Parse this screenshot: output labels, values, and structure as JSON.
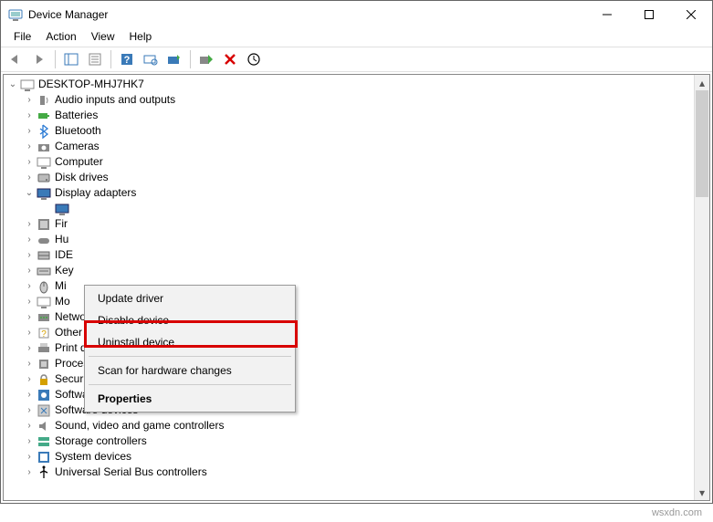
{
  "window": {
    "title": "Device Manager"
  },
  "menu": {
    "file": "File",
    "action": "Action",
    "view": "View",
    "help": "Help"
  },
  "root": {
    "name": "DESKTOP-MHJ7HK7"
  },
  "categories": [
    {
      "label": "Audio inputs and outputs",
      "icon": "audio"
    },
    {
      "label": "Batteries",
      "icon": "battery"
    },
    {
      "label": "Bluetooth",
      "icon": "bluetooth"
    },
    {
      "label": "Cameras",
      "icon": "camera"
    },
    {
      "label": "Computer",
      "icon": "computer"
    },
    {
      "label": "Disk drives",
      "icon": "disk"
    },
    {
      "label": "Display adapters",
      "icon": "display",
      "expanded": true
    },
    {
      "label": "Fir",
      "icon": "firmware",
      "truncated": true
    },
    {
      "label": "Hu",
      "icon": "hid",
      "truncated": true
    },
    {
      "label": "IDE",
      "icon": "ide",
      "truncated": true
    },
    {
      "label": "Key",
      "icon": "keyboard",
      "truncated": true
    },
    {
      "label": "Mi",
      "icon": "mouse",
      "truncated": true
    },
    {
      "label": "Mo",
      "icon": "monitor",
      "truncated": true
    },
    {
      "label": "Network adapters",
      "icon": "network"
    },
    {
      "label": "Other devices",
      "icon": "other"
    },
    {
      "label": "Print queues",
      "icon": "print"
    },
    {
      "label": "Processors",
      "icon": "cpu"
    },
    {
      "label": "Security devices",
      "icon": "security"
    },
    {
      "label": "Software components",
      "icon": "swcomp"
    },
    {
      "label": "Software devices",
      "icon": "swdev"
    },
    {
      "label": "Sound, video and game controllers",
      "icon": "sound"
    },
    {
      "label": "Storage controllers",
      "icon": "storage"
    },
    {
      "label": "System devices",
      "icon": "system"
    },
    {
      "label": "Universal Serial Bus controllers",
      "icon": "usb"
    }
  ],
  "context_menu": {
    "update": "Update driver",
    "disable": "Disable device",
    "uninstall": "Uninstall device",
    "scan": "Scan for hardware changes",
    "properties": "Properties"
  },
  "watermark": "wsxdn.com"
}
